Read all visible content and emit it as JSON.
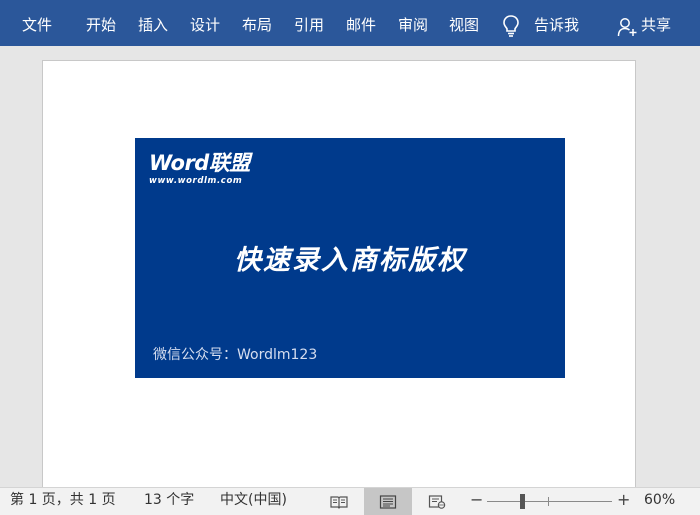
{
  "ribbon": {
    "tabs": [
      "文件",
      "开始",
      "插入",
      "设计",
      "布局",
      "引用",
      "邮件",
      "审阅",
      "视图"
    ],
    "tell_me": "告诉我",
    "share": "共享"
  },
  "document": {
    "banner": {
      "logo_text": "Word联盟",
      "logo_url": "www.wordlm.com",
      "title": "快速录入商标版权",
      "footer": "微信公众号：Wordlm123",
      "background": "#003a8c"
    }
  },
  "status_bar": {
    "page_info": "第 1 页，共 1 页",
    "word_count": "13 个字",
    "language": "中文(中国)",
    "zoom_minus": "−",
    "zoom_plus": "+",
    "zoom_level": "60%"
  },
  "colors": {
    "ribbon": "#2b579a",
    "banner": "#003a8c"
  }
}
